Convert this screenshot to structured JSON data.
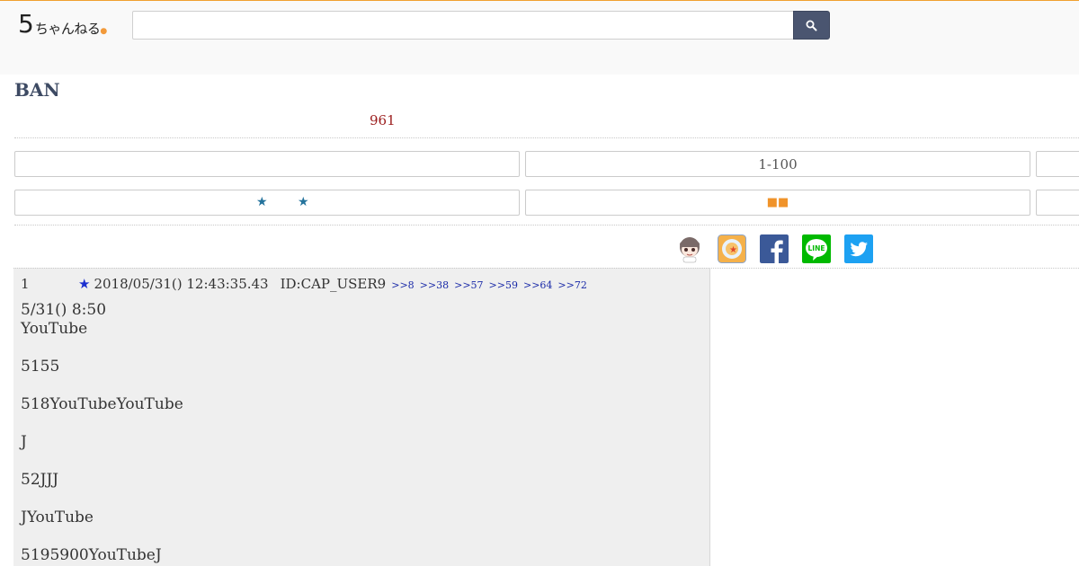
{
  "header": {
    "logo": {
      "big": "5",
      "small": "ちゃんねる",
      "dot": "●"
    },
    "search": {
      "value": "",
      "placeholder": ""
    },
    "search_icon": "search-icon"
  },
  "thread": {
    "title": "BAN",
    "response_count": "961"
  },
  "nav": {
    "row1": {
      "left": "",
      "middle": "1-100",
      "right": ""
    },
    "row2": {
      "left_stars": [
        "★",
        "★"
      ],
      "middle_squares": "■■",
      "right": ""
    }
  },
  "share": [
    {
      "name": "mascot-icon",
      "color": "#f2ece6"
    },
    {
      "name": "app-icon",
      "color": "#f5b14a"
    },
    {
      "name": "facebook-icon",
      "color": "#3b5998"
    },
    {
      "name": "line-icon",
      "color": "#00b900"
    },
    {
      "name": "twitter-icon",
      "color": "#1da1f2"
    }
  ],
  "post": {
    "number": "1",
    "star": "★",
    "date": "2018/05/31() 12:43:35.43",
    "id": "ID:CAP_USER9",
    "anchors": [
      ">>8",
      ">>38",
      ">>57",
      ">>59",
      ">>64",
      ">>72"
    ],
    "body": "5/31() 8:50\nYouTube\n\n5155\n\n518YouTubeYouTube\n\nJ\n\n52JJJ\n\nJYouTube\n\n5195900YouTubeJ"
  },
  "colors": {
    "accent_top_border": "#f0a030",
    "search_button": "#4a5570",
    "title": "#3d4a63",
    "count": "#9b1c1c",
    "anchor": "#1a2aa8",
    "post_bg": "#efefef"
  }
}
